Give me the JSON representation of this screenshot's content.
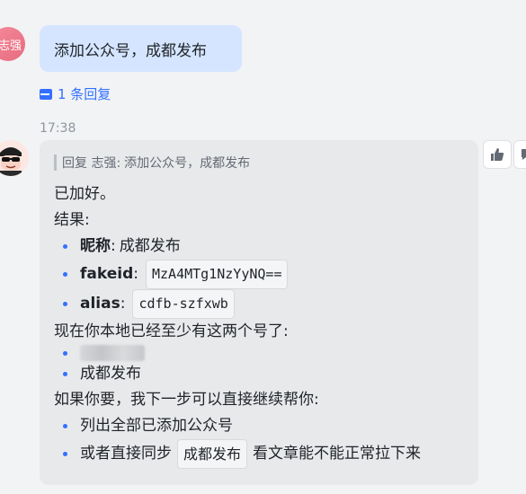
{
  "message1": {
    "avatar_text": "志强",
    "text": "添加公众号，成都发布",
    "reply_count_label": "1 条回复"
  },
  "timestamp": "17:38",
  "message2": {
    "quote_prefix": "回复 志强:",
    "quote_text": "添加公众号，成都发布",
    "line_added": "已加好。",
    "line_result": "结果:",
    "items": [
      {
        "label": "昵称",
        "sep": ":",
        "value": "成都发布"
      },
      {
        "label": "fakeid",
        "sep": ":",
        "value": "MzA4MTg1NzYyNQ=="
      },
      {
        "label": "alias",
        "sep": ":",
        "value": "cdfb-szfxwb"
      }
    ],
    "line_now": "现在你本地已经至少有这两个号了:",
    "accounts": [
      "",
      "成都发布"
    ],
    "line_next": "如果你要，我下一步可以直接继续帮你:",
    "options": {
      "opt1": "列出全部已添加公众号",
      "opt2_prefix": "或者直接同步",
      "opt2_code": "成都发布",
      "opt2_suffix": "看文章能不能正常拉下来"
    }
  },
  "colors": {
    "accent": "#3370ff",
    "bubble_blue": "#d5e5ff",
    "bubble_gray": "#e8e9eb"
  }
}
